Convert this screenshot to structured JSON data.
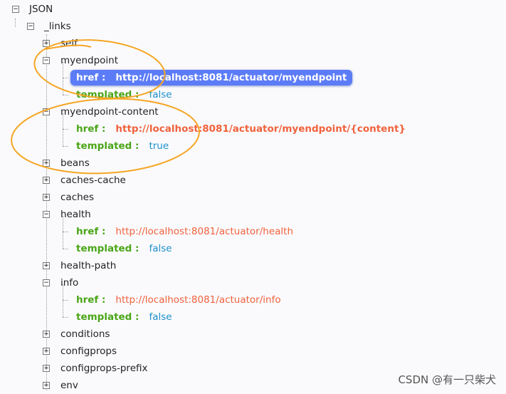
{
  "tree": {
    "root": "JSON",
    "links": "_links",
    "rows": [
      {
        "label": "self",
        "state": "collapsed"
      },
      {
        "label": "myendpoint",
        "state": "expanded"
      },
      {
        "key": "href :",
        "value": "http://localhost:8081/actuator/myendpoint",
        "style": "selected"
      },
      {
        "key": "templated :",
        "value": "false",
        "style": "bool"
      },
      {
        "label": "myendpoint-content",
        "state": "expanded"
      },
      {
        "key": "href :",
        "value": "http://localhost:8081/actuator/myendpoint/{content}",
        "style": "bold"
      },
      {
        "key": "templated :",
        "value": "true",
        "style": "bool"
      },
      {
        "label": "beans",
        "state": "collapsed"
      },
      {
        "label": "caches-cache",
        "state": "collapsed"
      },
      {
        "label": "caches",
        "state": "collapsed"
      },
      {
        "label": "health",
        "state": "expanded"
      },
      {
        "key": "href :",
        "value": "http://localhost:8081/actuator/health",
        "style": "url"
      },
      {
        "key": "templated :",
        "value": "false",
        "style": "bool"
      },
      {
        "label": "health-path",
        "state": "collapsed"
      },
      {
        "label": "info",
        "state": "expanded"
      },
      {
        "key": "href :",
        "value": "http://localhost:8081/actuator/info",
        "style": "url"
      },
      {
        "key": "templated :",
        "value": "false",
        "style": "bool"
      },
      {
        "label": "conditions",
        "state": "collapsed"
      },
      {
        "label": "configprops",
        "state": "collapsed"
      },
      {
        "label": "configprops-prefix",
        "state": "collapsed"
      },
      {
        "label": "env",
        "state": "collapsed"
      }
    ]
  },
  "watermark": "CSDN @有一只柴犬",
  "colors": {
    "key": "#4aa516",
    "url": "#f0623c",
    "bool": "#1c8fc9",
    "selection": "#5c7cf7",
    "annotation": "#f5a623"
  }
}
